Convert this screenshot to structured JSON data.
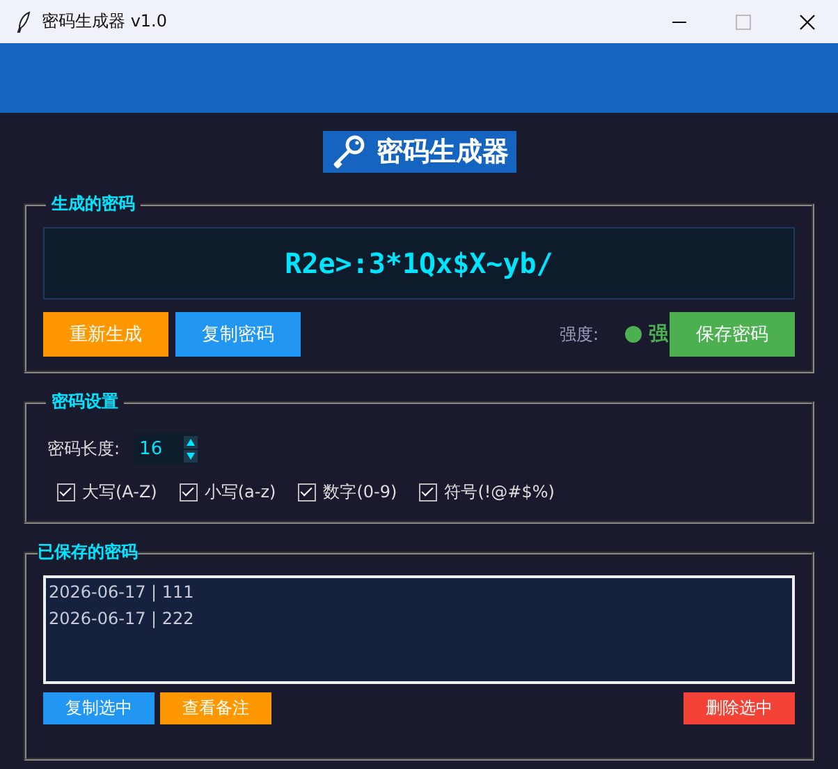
{
  "window": {
    "title": "密码生成器 v1.0"
  },
  "heading": "密码生成器",
  "generated": {
    "legend": "生成的密码",
    "password": "R2e>:3*1Qx$X~yb/",
    "buttons": [
      {
        "label": "重新生成",
        "kind": "warn"
      },
      {
        "label": "复制密码",
        "kind": "info"
      }
    ],
    "strength_label": "强度:",
    "strength": {
      "text": "强",
      "color": "#4caf50"
    },
    "save_button": "保存密码"
  },
  "settings": {
    "legend": "密码设置",
    "length_label": "密码长度:",
    "length": "16",
    "options": [
      {
        "label": "大写(A-Z)",
        "checked": true
      },
      {
        "label": "小写(a-z)",
        "checked": true
      },
      {
        "label": "数字(0-9)",
        "checked": true
      },
      {
        "label": "符号(!@#$%)",
        "checked": true
      }
    ]
  },
  "saved": {
    "legend": "已保存的密码",
    "items": [
      {
        "text": "2026-06-17 | 111",
        "selected": false
      },
      {
        "text": "2026-06-17 | 222",
        "selected": false
      }
    ],
    "buttons": [
      {
        "label": "复制选中",
        "kind": "info"
      },
      {
        "label": "查看备注",
        "kind": "warn"
      },
      {
        "label": "删除选中",
        "kind": "danger"
      }
    ]
  }
}
